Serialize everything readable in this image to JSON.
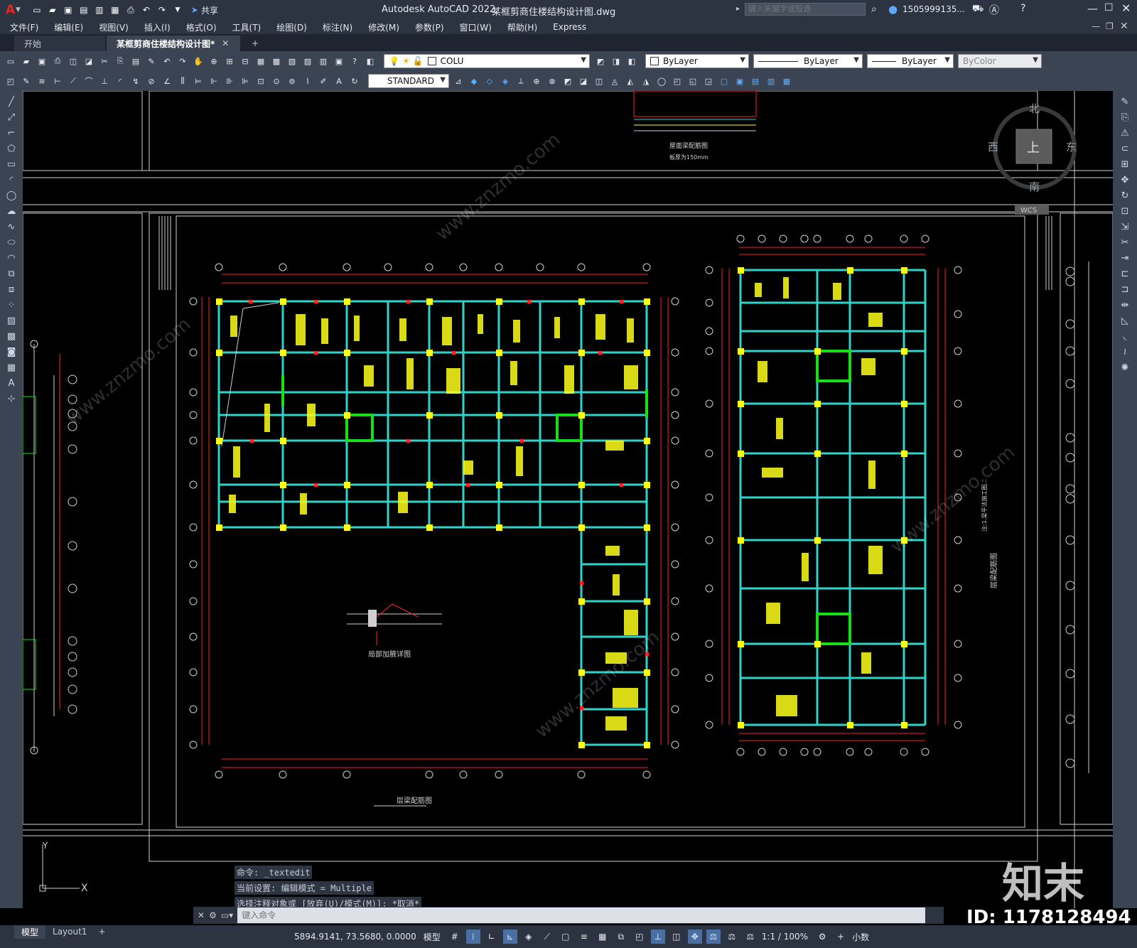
{
  "titlebar": {
    "app_title": "Autodesk AutoCAD 2022",
    "file_title": "某框剪商住楼结构设计图.dwg",
    "share_label": "共享",
    "search_placeholder": "键入关键字或短语",
    "user_name": "1505999135...",
    "logo_letter": "A"
  },
  "menu": [
    "文件(F)",
    "编辑(E)",
    "视图(V)",
    "插入(I)",
    "格式(O)",
    "工具(T)",
    "绘图(D)",
    "标注(N)",
    "修改(M)",
    "参数(P)",
    "窗口(W)",
    "帮助(H)",
    "Express"
  ],
  "tabs": {
    "start": "开始",
    "document": "某框剪商住楼结构设计图*",
    "add": "+"
  },
  "toolbar": {
    "layer_name": "COLU",
    "color": "ByLayer",
    "linetype": "ByLayer",
    "lineweight": "ByLayer",
    "plotstyle": "ByColor",
    "textstyle": "STANDARD"
  },
  "viewcube": {
    "north": "北",
    "south": "南",
    "east": "东",
    "west": "西",
    "top": "上",
    "wcs": "WCS"
  },
  "drawing": {
    "plan_title": "层梁配筋图",
    "detail_title": "局部加腋详图",
    "right_title": "层梁配筋图",
    "right_note": "注:1.梁平法施工图...",
    "top_title": "屋面梁配筋图",
    "top_subtitle": "板厚为150mm"
  },
  "command": {
    "history": [
      "命令: _textedit",
      "当前设置: 编辑模式 = Multiple",
      "选择注释对象或 [放弃(U)/模式(M)]: *取消*"
    ],
    "placeholder": "键入命令"
  },
  "layout_tabs": [
    "模型",
    "Layout1"
  ],
  "status": {
    "coords": "5894.9141, 73.5680, 0.0000",
    "space": "模型",
    "scale": "1:1 / 100%",
    "units": "小数"
  },
  "brand": {
    "logo": "知末",
    "id": "ID: 1178128494"
  },
  "colors": {
    "beam": "#2fd3c9",
    "column": "#ffff1a",
    "wall": "#18e018",
    "dimension": "#ff2020",
    "text": "#ffff1a",
    "frame": "#d0d0d0"
  }
}
